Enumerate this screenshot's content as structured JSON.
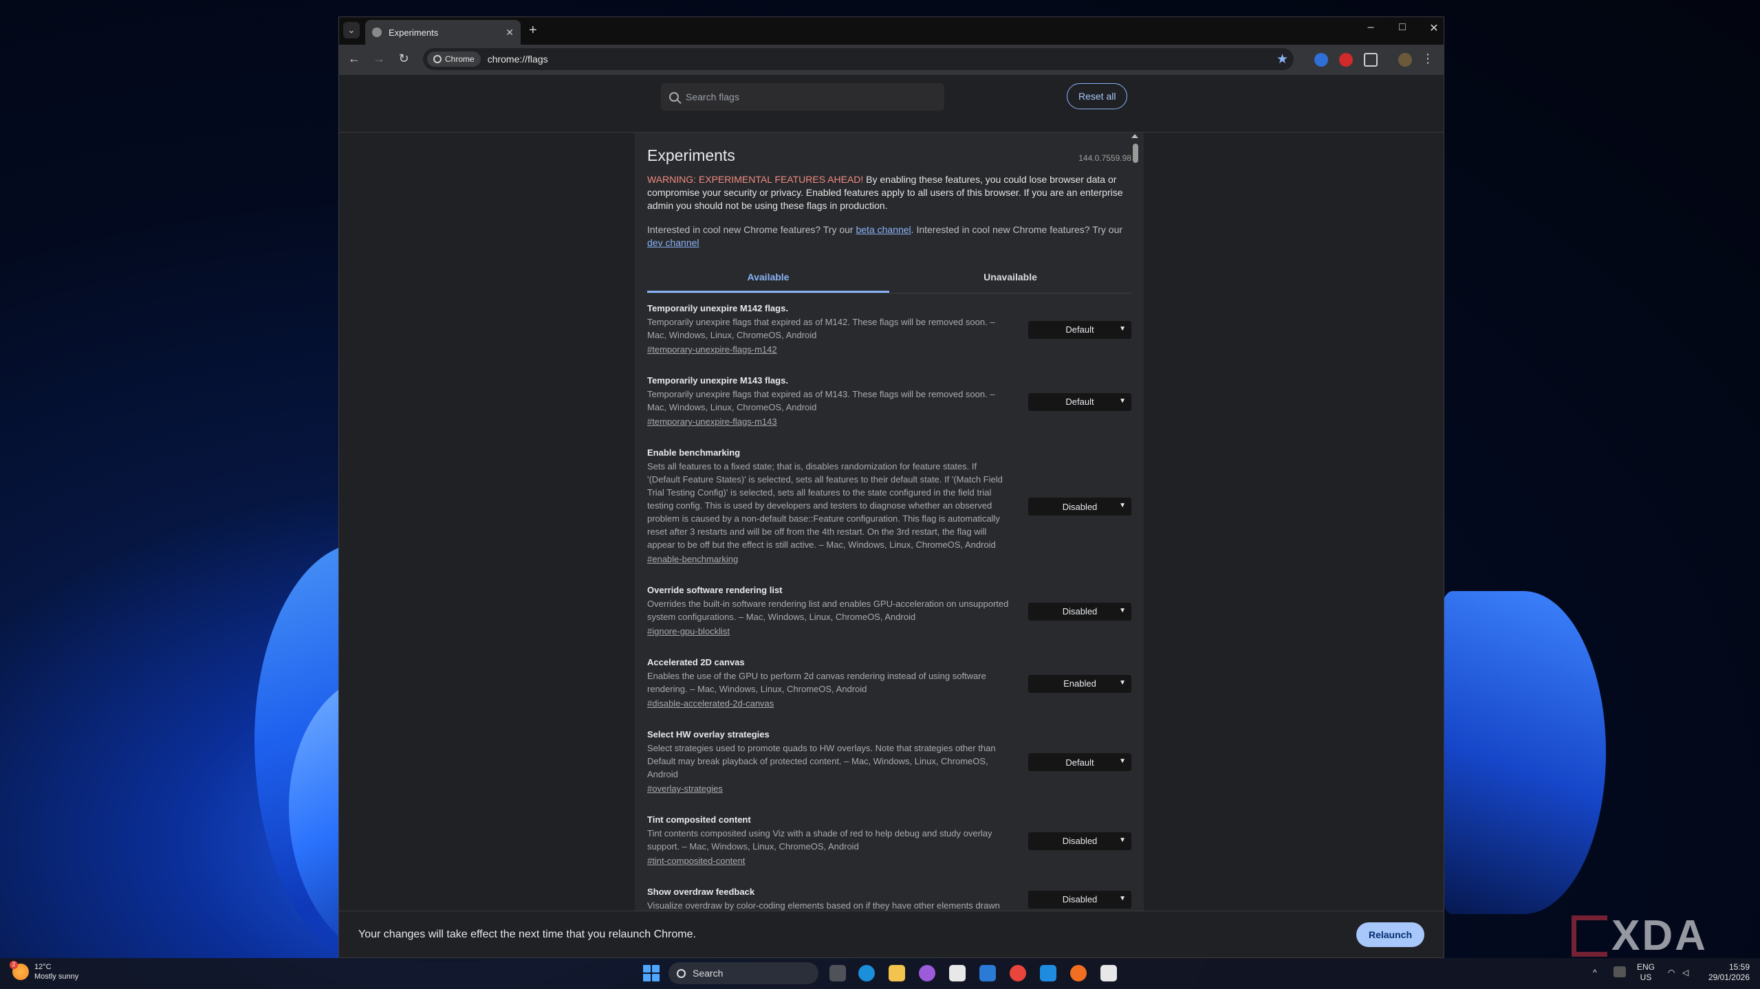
{
  "browser": {
    "tab_title": "Experiments",
    "chip_label": "Chrome",
    "url": "chrome://flags"
  },
  "flags_header": {
    "search_placeholder": "Search flags",
    "reset_label": "Reset all"
  },
  "page": {
    "title": "Experiments",
    "version": "144.0.7559.98",
    "warning_highlight": "WARNING: EXPERIMENTAL FEATURES AHEAD!",
    "warning_rest": " By enabling these features, you could lose browser data or compromise your security or privacy. Enabled features apply to all users of this browser. If you are an enterprise admin you should not be using these flags in production.",
    "interest_a": "Interested in cool new Chrome features? Try our ",
    "beta_link": "beta channel",
    "interest_b": ". Interested in cool new Chrome features? Try our ",
    "dev_link": "dev channel",
    "tab_available": "Available",
    "tab_unavailable": "Unavailable"
  },
  "flags": [
    {
      "name": "Temporarily unexpire M142 flags.",
      "desc": "Temporarily unexpire flags that expired as of M142. These flags will be removed soon. – Mac, Windows, Linux, ChromeOS, Android",
      "link": "#temporary-unexpire-flags-m142",
      "value": "Default"
    },
    {
      "name": "Temporarily unexpire M143 flags.",
      "desc": "Temporarily unexpire flags that expired as of M143. These flags will be removed soon. – Mac, Windows, Linux, ChromeOS, Android",
      "link": "#temporary-unexpire-flags-m143",
      "value": "Default"
    },
    {
      "name": "Enable benchmarking",
      "desc": "Sets all features to a fixed state; that is, disables randomization for feature states. If '(Default Feature States)' is selected, sets all features to their default state. If '(Match Field Trial Testing Config)' is selected, sets all features to the state configured in the field trial testing config. This is used by developers and testers to diagnose whether an observed problem is caused by a non-default base::Feature configuration. This flag is automatically reset after 3 restarts and will be off from the 4th restart. On the 3rd restart, the flag will appear to be off but the effect is still active. – Mac, Windows, Linux, ChromeOS, Android",
      "link": "#enable-benchmarking",
      "value": "Disabled"
    },
    {
      "name": "Override software rendering list",
      "desc": "Overrides the built-in software rendering list and enables GPU-acceleration on unsupported system configurations. – Mac, Windows, Linux, ChromeOS, Android",
      "link": "#ignore-gpu-blocklist",
      "value": "Disabled"
    },
    {
      "name": "Accelerated 2D canvas",
      "desc": "Enables the use of the GPU to perform 2d canvas rendering instead of using software rendering. – Mac, Windows, Linux, ChromeOS, Android",
      "link": "#disable-accelerated-2d-canvas",
      "value": "Enabled"
    },
    {
      "name": "Select HW overlay strategies",
      "desc": "Select strategies used to promote quads to HW overlays. Note that strategies other than Default may break playback of protected content. – Mac, Windows, Linux, ChromeOS, Android",
      "link": "#overlay-strategies",
      "value": "Default"
    },
    {
      "name": "Tint composited content",
      "desc": "Tint contents composited using Viz with a shade of red to help debug and study overlay support. – Mac, Windows, Linux, ChromeOS, Android",
      "link": "#tint-composited-content",
      "value": "Disabled"
    },
    {
      "name": "Show overdraw feedback",
      "desc": "Visualize overdraw by color-coding elements based on if they have other elements drawn",
      "link": "",
      "value": "Disabled"
    }
  ],
  "relaunch": {
    "message": "Your changes will take effect the next time that you relaunch Chrome.",
    "button": "Relaunch"
  },
  "taskbar": {
    "weather_temp": "12°C",
    "weather_desc": "Mostly sunny",
    "weather_badge": "2",
    "search_label": "Search",
    "lang": "ENG",
    "region": "US",
    "time": "15:59",
    "date": "29/01/2026"
  },
  "watermark": "XDA",
  "colors": {
    "accent": "#8ab4f8",
    "warning": "#f28b82",
    "relaunch_button": "#a8c7fa"
  }
}
